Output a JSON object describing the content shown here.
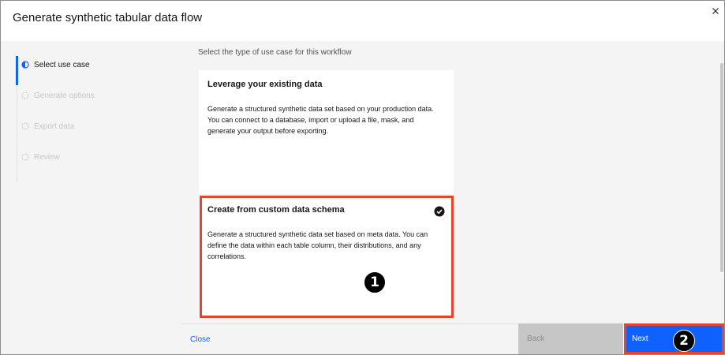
{
  "modal": {
    "title": "Generate synthetic tabular data flow"
  },
  "steps": [
    {
      "label": "Select use case",
      "state": "current"
    },
    {
      "label": "Generate options",
      "state": "incomplete"
    },
    {
      "label": "Export data",
      "state": "incomplete"
    },
    {
      "label": "Review",
      "state": "incomplete"
    }
  ],
  "main": {
    "subtitle": "Select the type of use case for this workflow",
    "tiles": [
      {
        "title": "Leverage your existing data",
        "description": "Generate a structured synthetic data set based on your production data. You can connect to a database, import or upload a file, mask, and generate your output before exporting.",
        "selected": false
      },
      {
        "title": "Create from custom data schema",
        "description": "Generate a structured synthetic data set based on meta data. You can define the data within each table column, their distributions, and any correlations.",
        "selected": true
      }
    ]
  },
  "footer": {
    "close_label": "Close",
    "back_label": "Back",
    "next_label": "Next"
  },
  "callouts": {
    "one": "1",
    "two": "2"
  },
  "colors": {
    "primary": "#0f62fe",
    "highlight": "#e8442c",
    "disabled": "#c6c6c6"
  },
  "icons": {
    "close": "close-icon",
    "current_step": "half-circle-step-icon",
    "incomplete_step": "dashed-circle-step-icon",
    "selected": "checkmark-filled-icon"
  }
}
